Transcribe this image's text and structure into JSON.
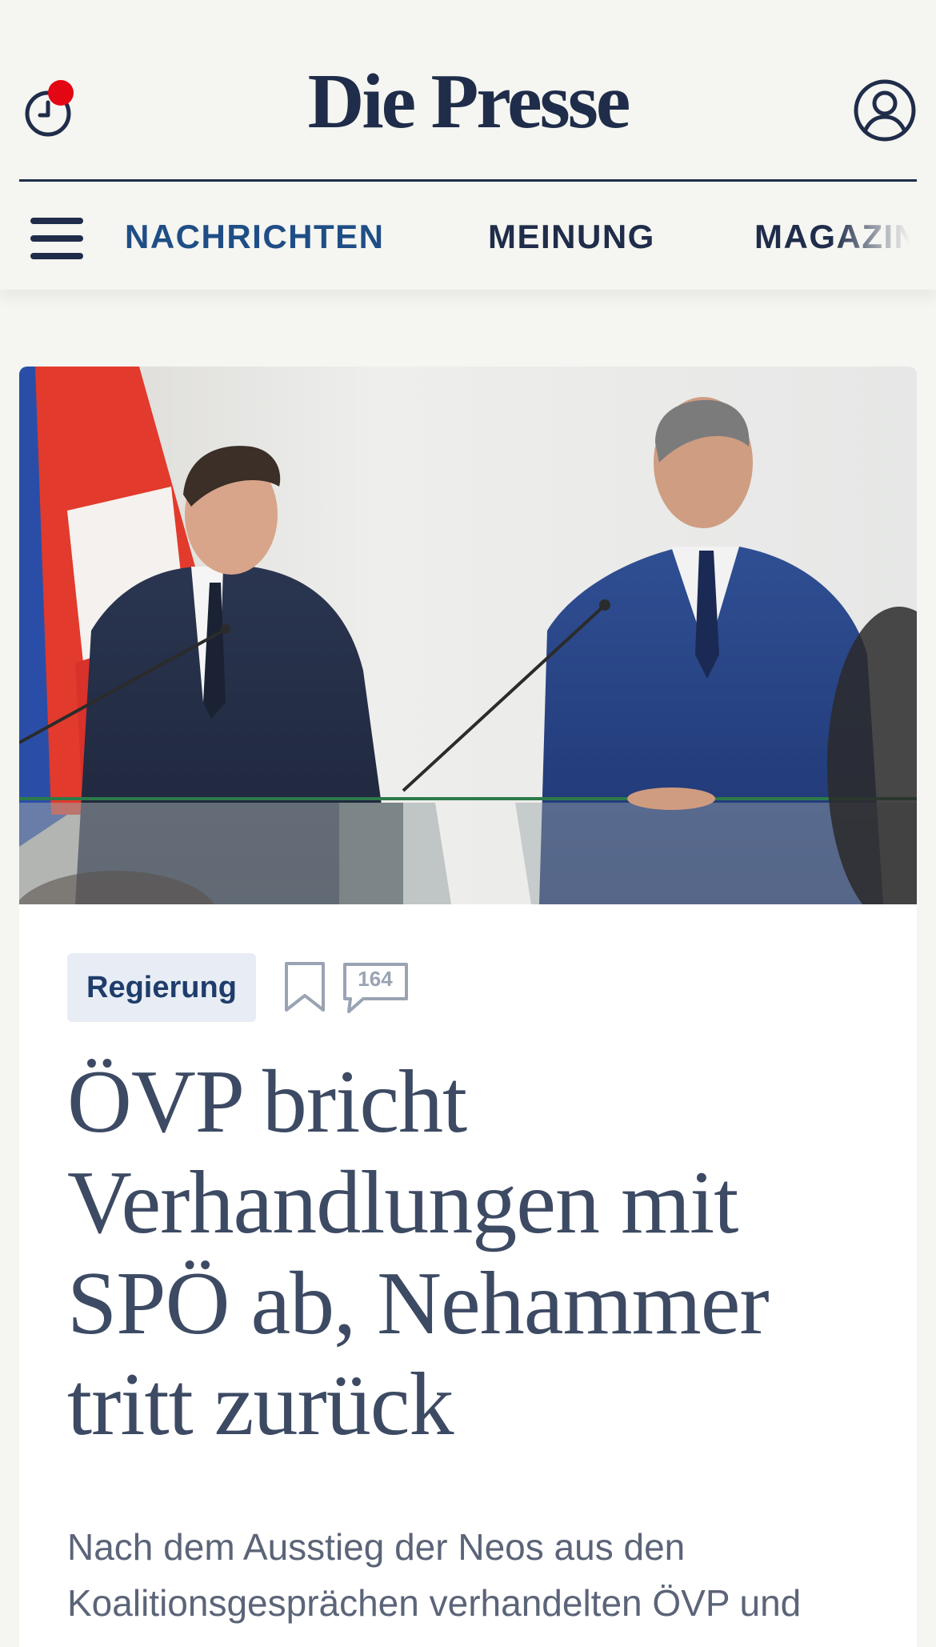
{
  "header": {
    "logo_text": "Die Presse",
    "history_icon": "clock-icon",
    "notification_dot_color": "#e30613",
    "account_icon": "user-icon"
  },
  "nav": {
    "menu_icon": "hamburger-menu-icon",
    "items": [
      {
        "label": "NACHRICHTEN",
        "active": true
      },
      {
        "label": "MEINUNG",
        "active": false
      },
      {
        "label": "MAGAZIN",
        "active": false
      }
    ]
  },
  "article": {
    "image_description_icon": "photo",
    "tag": "Regierung",
    "bookmark_icon": "bookmark-icon",
    "comments_icon": "speech-bubble-icon",
    "comments_count": "164",
    "headline": "ÖVP bricht Verhandlungen mit SPÖ ab, Nehammer tritt zurück",
    "lead": "Nach dem Ausstieg der Neos aus den Koalitionsgesprächen verhandelten ÖVP und"
  },
  "colors": {
    "brand_navy": "#1f2d4a",
    "nav_active": "#1f4e86",
    "tag_background": "#e8edf5",
    "headline": "#3d4a63",
    "page_background": "#f5f5f1"
  }
}
